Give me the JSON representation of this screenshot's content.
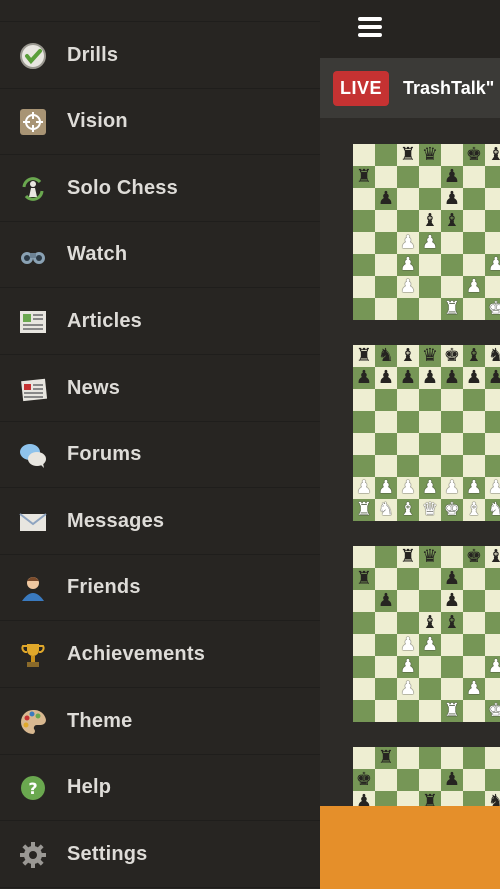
{
  "sidebar": {
    "items": [
      {
        "label": "Drills",
        "icon": "check-badge-icon"
      },
      {
        "label": "Vision",
        "icon": "crosshair-icon"
      },
      {
        "label": "Solo Chess",
        "icon": "pawn-cycle-icon"
      },
      {
        "label": "Watch",
        "icon": "binoculars-icon"
      },
      {
        "label": "Articles",
        "icon": "article-icon"
      },
      {
        "label": "News",
        "icon": "newspaper-icon"
      },
      {
        "label": "Forums",
        "icon": "chat-bubbles-icon"
      },
      {
        "label": "Messages",
        "icon": "envelope-icon"
      },
      {
        "label": "Friends",
        "icon": "person-icon"
      },
      {
        "label": "Achievements",
        "icon": "trophy-icon"
      },
      {
        "label": "Theme",
        "icon": "palette-icon"
      },
      {
        "label": "Help",
        "icon": "help-icon"
      },
      {
        "label": "Settings",
        "icon": "gear-icon"
      }
    ]
  },
  "header": {
    "menu_icon": "hamburger-icon"
  },
  "live": {
    "badge": "LIVE",
    "title": "TrashTalk\""
  },
  "colors": {
    "board_light": "#eeeed2",
    "board_dark": "#769656",
    "live_red": "#c53232",
    "accent_orange": "#e58f2a"
  },
  "boards": [
    {
      "rows": [
        "  RQ KB",
        "R   P  ",
        " P  P  ",
        "   BB  ",
        "  PP   ",
        "  P   P",
        "  P  P ",
        "    R K"
      ]
    },
    {
      "rows": [
        "RNBQKBNR",
        "PPPPPPPP",
        "        ",
        "        ",
        "        ",
        "        ",
        "PPPPPPPP",
        "RNBQKBNR"
      ]
    },
    {
      "rows": [
        "  RQ KB",
        "R   P  ",
        " P  P  ",
        "   BB  ",
        "  PP   ",
        "  P   P",
        "  P  P ",
        "    R K"
      ]
    },
    {
      "rows": [
        " R      ",
        "K   P   ",
        "P  R  N "
      ]
    }
  ]
}
